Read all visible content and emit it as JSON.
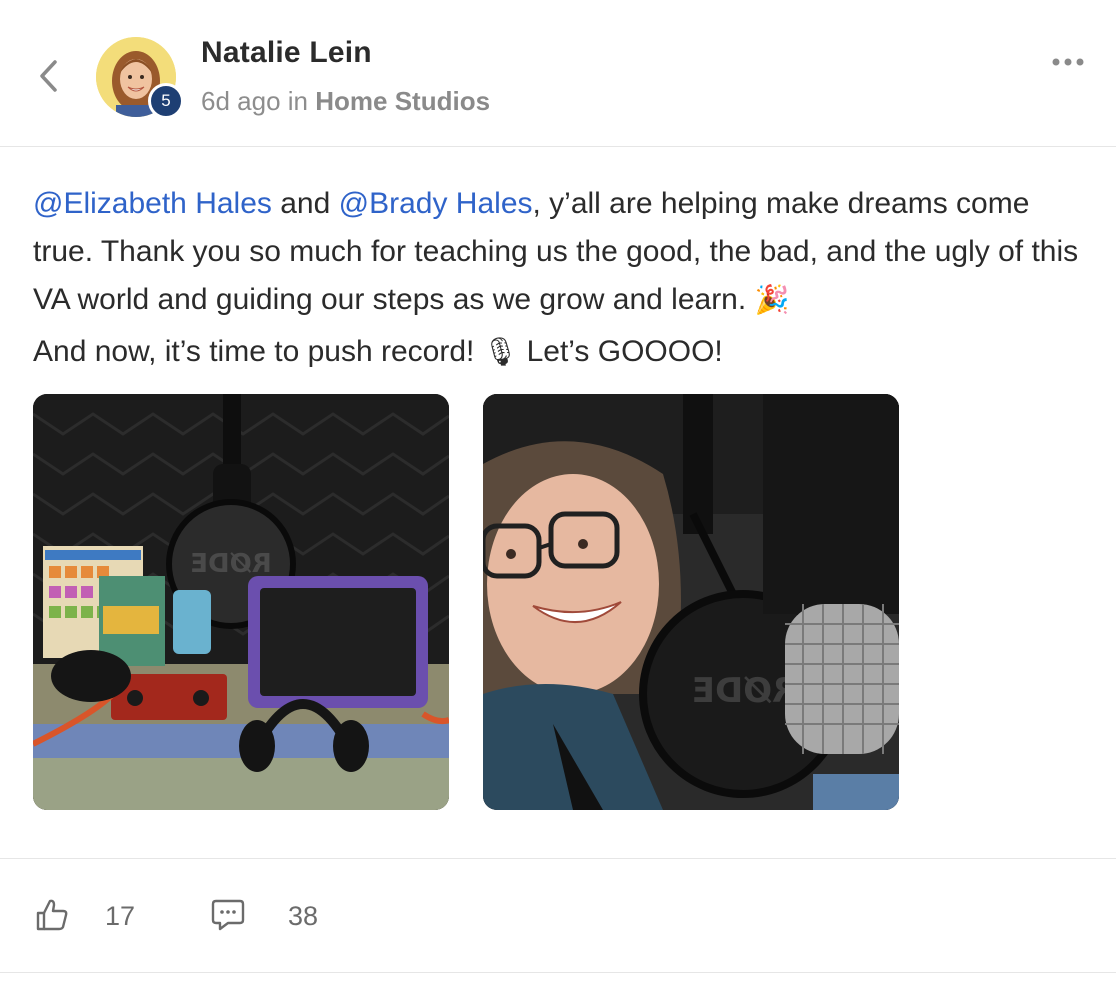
{
  "post": {
    "author": "Natalie Lein",
    "level": "5",
    "time_ago": "6d ago",
    "in_word": "in",
    "group": "Home Studios"
  },
  "content": {
    "mention_1": "@Elizabeth Hales",
    "and_word": " and ",
    "mention_2": "@Brady Hales",
    "line_1_rest": ", y’all are helping make dreams come true. Thank you so much for teaching us the good, the bad, and the ugly of this VA world and guiding our steps as we grow and learn. ",
    "party_emoji": "🎉",
    "line_2_start": "And now, it’s time to push record! ",
    "mic_emoji": "🎙",
    "line_2_end": " Let’s GOOOO!"
  },
  "photos": {
    "photo_1_text": "RØDE",
    "photo_2_text": "RØDE"
  },
  "reactions": {
    "likes": "17",
    "comments": "38"
  },
  "icons": {
    "back": "chevron-left-icon",
    "more": "more-horizontal-icon",
    "like": "thumbs-up-icon",
    "comment": "comment-icon"
  },
  "colors": {
    "mention": "#2f63c9",
    "badge": "#1e3f73"
  }
}
